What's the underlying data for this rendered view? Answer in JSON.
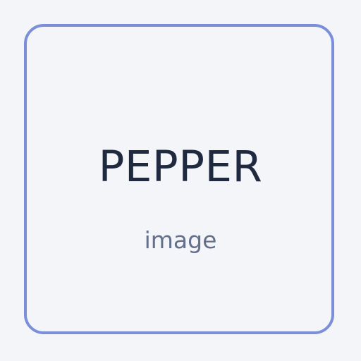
{
  "card": {
    "title": "PEPPER",
    "subtitle": "image"
  },
  "colors": {
    "background": "#f4f5f8",
    "border": "#7b8fd9",
    "title": "#1f2940",
    "subtitle": "#64708a"
  }
}
